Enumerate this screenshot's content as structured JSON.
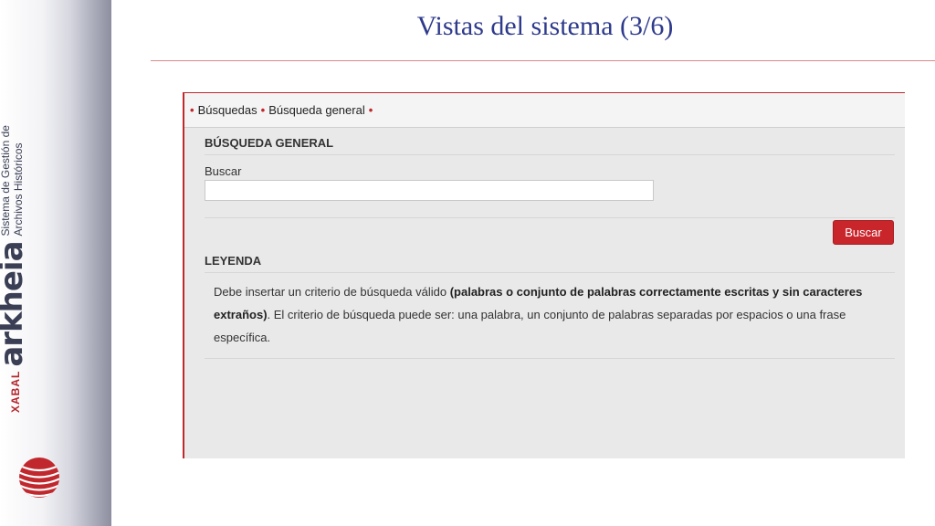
{
  "slide": {
    "title": "Vistas del sistema (3/6)"
  },
  "branding": {
    "xabal": "XABAL",
    "name": "arkheia",
    "subtitle_line1": "Sistema de Gestión de",
    "subtitle_line2": "Archivos Históricos",
    "accent_color": "#c0282d",
    "title_color": "#2e3a8c"
  },
  "breadcrumb": {
    "items": [
      "Búsquedas",
      "Búsqueda general"
    ]
  },
  "search_section": {
    "heading": "BÚSQUEDA GENERAL",
    "field_label": "Buscar",
    "field_value": "",
    "button_label": "Buscar"
  },
  "legend_section": {
    "heading": "LEYENDA",
    "text_start": "Debe insertar un criterio de búsqueda válido ",
    "text_bold": "(palabras o conjunto de palabras correctamente escritas y sin caracteres extraños)",
    "text_end": ". El criterio de búsqueda puede ser: una palabra, un conjunto de palabras separadas por espacios o una frase específica."
  }
}
